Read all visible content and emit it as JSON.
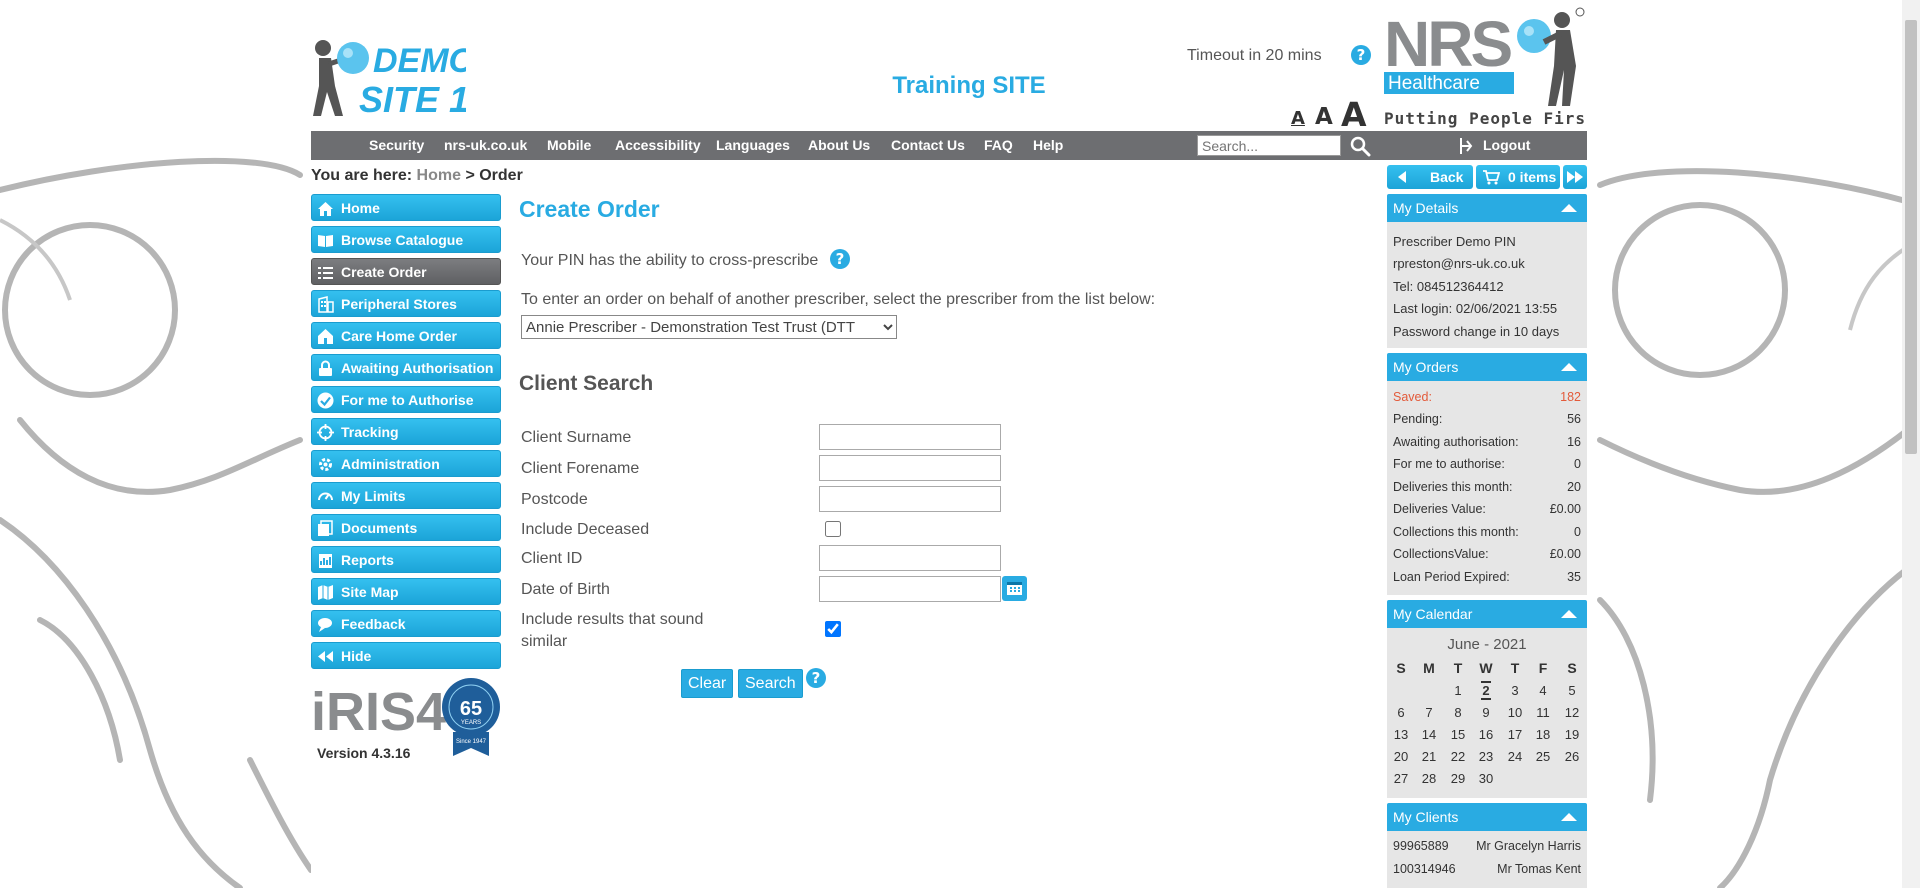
{
  "header": {
    "logo_text_line1": "DEMO",
    "logo_text_line2": "SITE 1",
    "site_label": "Training SITE",
    "timeout": "Timeout in 20 mins",
    "help_glyph": "?",
    "font_sizes": [
      "A",
      "A",
      "A"
    ],
    "nrs_logo_line1": "NRS",
    "nrs_logo_line2": "Healthcare",
    "nrs_logo_tagline": "Putting People First"
  },
  "nav": {
    "items": [
      "Security",
      "nrs-uk.co.uk",
      "Mobile",
      "Accessibility",
      "Languages",
      "About Us",
      "Contact Us",
      "FAQ",
      "Help"
    ],
    "search_placeholder": "Search...",
    "logout": "Logout"
  },
  "breadcrumb": {
    "prefix": "You are here:",
    "home": "Home",
    "separator": ">",
    "current": "Order"
  },
  "menu": {
    "items": [
      {
        "label": "Home",
        "icon": "house-icon"
      },
      {
        "label": "Browse Catalogue",
        "icon": "book-icon"
      },
      {
        "label": "Create Order",
        "icon": "list-icon"
      },
      {
        "label": "Peripheral Stores",
        "icon": "building-icon"
      },
      {
        "label": "Care Home Order",
        "icon": "home-icon"
      },
      {
        "label": "Awaiting Authorisation",
        "icon": "lock-icon"
      },
      {
        "label": "For me to Authorise",
        "icon": "check-circle-icon"
      },
      {
        "label": "Tracking",
        "icon": "crosshair-icon"
      },
      {
        "label": "Administration",
        "icon": "gear-icon"
      },
      {
        "label": "My Limits",
        "icon": "gauge-icon"
      },
      {
        "label": "Documents",
        "icon": "documents-icon"
      },
      {
        "label": "Reports",
        "icon": "report-icon"
      },
      {
        "label": "Site Map",
        "icon": "map-icon"
      },
      {
        "label": "Feedback",
        "icon": "chat-icon"
      },
      {
        "label": "Hide",
        "icon": "rewind-icon"
      }
    ],
    "active_index": 2,
    "iris_logo_text": "iRIS4",
    "badge_text": "65",
    "badge_sub": "YEARS",
    "badge_since": "Since 1947",
    "version": "Version 4.3.16"
  },
  "main": {
    "title": "Create Order",
    "pin_text": "Your PIN has the ability to cross-prescribe",
    "behalf_text": "To enter an order on behalf of another prescriber, select the prescriber from the list below:",
    "prescriber_selected": "Annie Prescriber - Demonstration Test Trust (DTT",
    "client_search_title": "Client Search",
    "labels": {
      "surname": "Client Surname",
      "forename": "Client Forename",
      "postcode": "Postcode",
      "deceased": "Include Deceased",
      "client_id": "Client ID",
      "dob": "Date of Birth",
      "similar_line1": "Include results that sound",
      "similar_line2": "similar"
    },
    "values": {
      "surname": "",
      "forename": "",
      "postcode": "",
      "client_id": "",
      "dob": ""
    },
    "include_deceased": false,
    "include_similar": true,
    "clear_label": "Clear",
    "search_label": "Search"
  },
  "right": {
    "back_label": "Back",
    "basket_label": "0 items",
    "details": {
      "title": "My Details",
      "name": "Prescriber Demo PIN",
      "email": "rpreston@nrs-uk.co.uk",
      "tel": "Tel: 084512364412",
      "last_login": "Last login: 02/06/2021 13:55",
      "password": "Password change in 10 days"
    },
    "orders": {
      "title": "My Orders",
      "rows": [
        {
          "label": "Saved:",
          "value": "182"
        },
        {
          "label": "Pending:",
          "value": "56"
        },
        {
          "label": "Awaiting authorisation:",
          "value": "16"
        },
        {
          "label": "For me to authorise:",
          "value": "0"
        },
        {
          "label": "Deliveries this month:",
          "value": "20"
        },
        {
          "label": "Deliveries Value:",
          "value": "£0.00"
        },
        {
          "label": "Collections this month:",
          "value": "0"
        },
        {
          "label": "CollectionsValue:",
          "value": "£0.00"
        },
        {
          "label": "Loan Period Expired:",
          "value": "35"
        }
      ]
    },
    "calendar": {
      "title": "My Calendar",
      "month": "June - 2021",
      "dow": [
        "S",
        "M",
        "T",
        "W",
        "T",
        "F",
        "S"
      ],
      "weeks": [
        [
          "",
          "",
          "1",
          "2",
          "3",
          "4",
          "5"
        ],
        [
          "6",
          "7",
          "8",
          "9",
          "10",
          "11",
          "12"
        ],
        [
          "13",
          "14",
          "15",
          "16",
          "17",
          "18",
          "19"
        ],
        [
          "20",
          "21",
          "22",
          "23",
          "24",
          "25",
          "26"
        ],
        [
          "27",
          "28",
          "29",
          "30",
          "",
          "",
          ""
        ]
      ],
      "today": "2"
    },
    "clients": {
      "title": "My Clients",
      "rows": [
        {
          "id": "99965889",
          "name": "Mr Gracelyn Harris"
        },
        {
          "id": "100314946",
          "name": "Mr Tomas Kent"
        }
      ]
    }
  },
  "colors": {
    "accent": "#29abe2",
    "nav_bg": "#6d6e71",
    "active_menu": "#6d6e71",
    "panel_bg": "#e6e6e6",
    "saved_red": "#e35a3a"
  }
}
